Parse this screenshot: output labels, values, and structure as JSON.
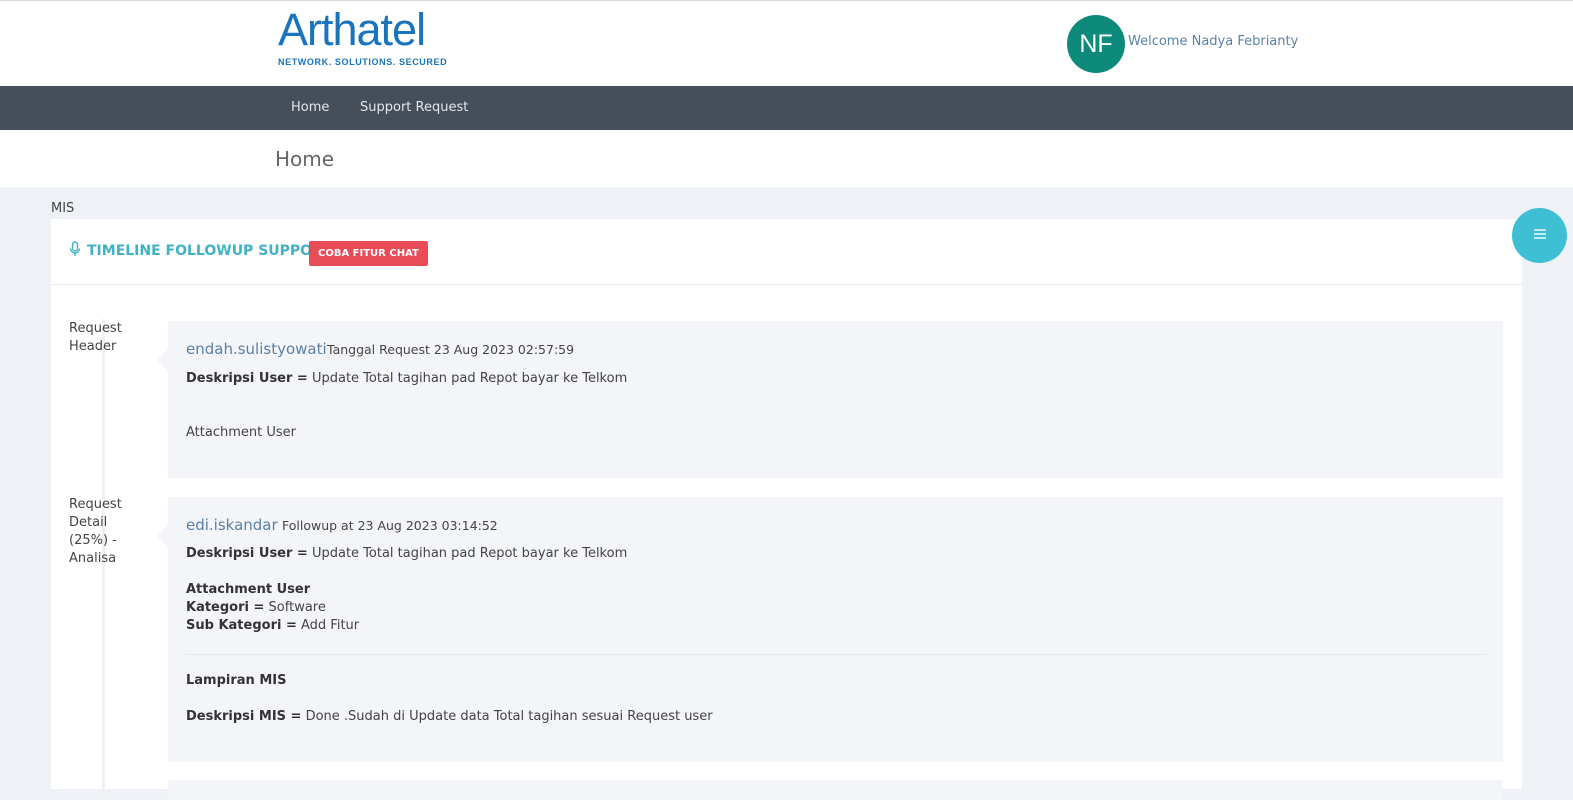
{
  "header": {
    "logo_text": "Arthatel",
    "logo_tagline": "NETWORK. SOLUTIONS. SECURED",
    "avatar_initials": "NF",
    "welcome_text": "Welcome Nadya Febrianty"
  },
  "nav": {
    "items": [
      {
        "label": "Home"
      },
      {
        "label": "Support Request"
      }
    ]
  },
  "page": {
    "title": "Home",
    "section_label": "MIS"
  },
  "card": {
    "title": "TIMELINE FOLLOWUP SUPPORT",
    "chat_button": "COBA FITUR CHAT"
  },
  "timeline": {
    "entries": [
      {
        "label": "Request Header",
        "user": "endah.sulistyowati",
        "meta": "Tanggal Request 23 Aug 2023 02:57:59",
        "desc_label": "Deskripsi User =",
        "desc_value": "Update Total tagihan pad Repot bayar ke Telkom",
        "attachment": "Attachment User"
      },
      {
        "label": "Request Detail (25%) - Analisa",
        "user": "edi.iskandar",
        "meta": "Followup at 23 Aug 2023 03:14:52",
        "desc_label": "Deskripsi User =",
        "desc_value": "Update Total tagihan pad Repot bayar ke Telkom",
        "attachment": "Attachment User",
        "kategori_label": "Kategori =",
        "kategori_value": "Software",
        "subkategori_label": "Sub Kategori =",
        "subkategori_value": "Add Fitur",
        "lampiran": "Lampiran MIS",
        "mis_label": "Deskripsi MIS =",
        "mis_value": "Done .Sudah di Update data Total tagihan sesuai Request user"
      }
    ]
  },
  "colors": {
    "brand_blue": "#1a74bb",
    "navbar": "#464e59",
    "accent_teal": "#40b2c6",
    "chat_button": "#e84c57",
    "avatar": "#0e8a7d"
  },
  "icons": {
    "title_icon": "microphone-icon",
    "fab_icon": "menu-icon"
  }
}
